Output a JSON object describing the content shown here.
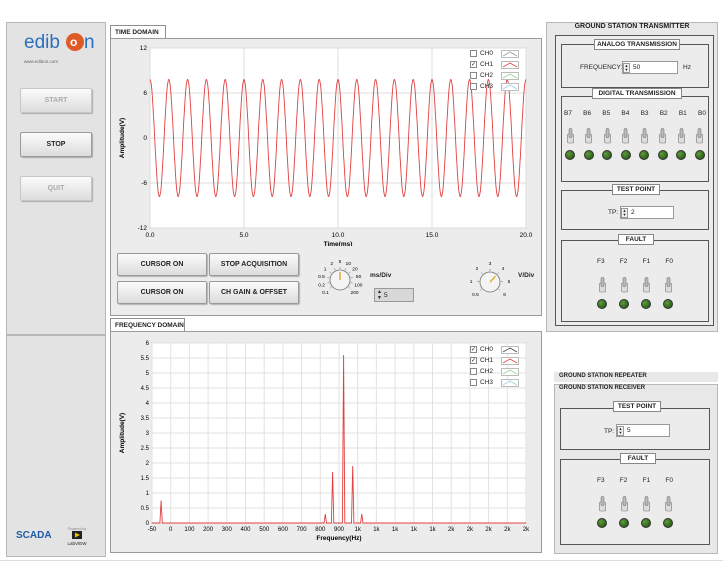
{
  "logo_text": "edibon",
  "logo_url": "www.edibon.com",
  "sidebar": {
    "start": "START",
    "stop": "STOP",
    "quit": "QUIT",
    "scada": "SCADA",
    "labview_powered": "Powered by",
    "labview": "LabVIEW"
  },
  "time_domain": {
    "tab": "TIME DOMAIN",
    "chart_data": {
      "type": "line",
      "title": "",
      "xlabel": "Time(ms)",
      "ylabel": "Amplitude(V)",
      "xlim": [
        0,
        20
      ],
      "ylim": [
        -12,
        12
      ],
      "xticks": [
        "0.0",
        "5.0",
        "10.0",
        "15.0",
        "20.0"
      ],
      "yticks": [
        "12",
        "6",
        "0",
        "-6",
        "-12"
      ],
      "grid": true,
      "series": [
        {
          "name": "CH1",
          "color": "#e04040",
          "type": "sine",
          "amplitude": 7.8,
          "frequency_khz": 1,
          "phase_deg": 90
        }
      ],
      "legend": [
        {
          "name": "CH0",
          "checked": false
        },
        {
          "name": "CH1",
          "checked": true
        },
        {
          "name": "CH2",
          "checked": false
        },
        {
          "name": "CH3",
          "checked": false
        }
      ]
    },
    "buttons": {
      "cursor_on_1": "CURSOR ON",
      "stop_acq": "STOP ACQUISITION",
      "cursor_on_2": "CURSOR ON",
      "ch_gain": "CH GAIN & OFFSET"
    },
    "ms_knob": {
      "label": "ms/Div",
      "ticks": [
        "0.1",
        "0.2",
        "0.5",
        "1",
        "2",
        "5",
        "10",
        "20",
        "50",
        "100",
        "200"
      ],
      "value": "5"
    },
    "v_knob": {
      "label": "V/Div",
      "ticks": [
        "0.5",
        "1",
        "2",
        "3",
        "4",
        "5",
        "6"
      ]
    }
  },
  "freq_domain": {
    "tab": "FREQUENCY DOMAIN",
    "chart_data": {
      "type": "line",
      "title": "",
      "xlabel": "Frequency(Hz)",
      "ylabel": "Amplitude(V)",
      "xlim": [
        -50,
        2000
      ],
      "ylim": [
        0,
        6
      ],
      "xticks": [
        "-50",
        "0",
        "100",
        "200",
        "300",
        "400",
        "500",
        "600",
        "700",
        "800",
        "900",
        "1k",
        "1k",
        "1k",
        "1k",
        "1k",
        "2k",
        "2k",
        "2k",
        "2k",
        "2k"
      ],
      "yticks": [
        "6",
        "5.5",
        "5",
        "4.5",
        "4",
        "3.5",
        "3",
        "2.5",
        "2",
        "1.5",
        "1",
        "0.5",
        "0"
      ],
      "grid": true,
      "series": [
        {
          "name": "CH1",
          "color": "#e04040",
          "peaks": [
            {
              "x": 0,
              "y": 0.75
            },
            {
              "x": 900,
              "y": 0.3
            },
            {
              "x": 940,
              "y": 1.7
            },
            {
              "x": 1000,
              "y": 5.6
            },
            {
              "x": 1050,
              "y": 1.9
            },
            {
              "x": 1100,
              "y": 0.3
            }
          ]
        }
      ],
      "legend": [
        {
          "name": "CH0",
          "checked": true
        },
        {
          "name": "CH1",
          "checked": true
        },
        {
          "name": "CH2",
          "checked": false
        },
        {
          "name": "CH3",
          "checked": false
        }
      ]
    }
  },
  "transmitter": {
    "title": "GROUND STATION TRANSMITTER",
    "analog_title": "ANALOG TRANSMISSION",
    "frequency_label": "FREQUENCY:",
    "frequency_value": "50",
    "frequency_unit": "Hz",
    "digital_title": "DIGITAL TRANSMISSION",
    "bits": [
      "B7",
      "B6",
      "B5",
      "B4",
      "B3",
      "B2",
      "B1",
      "B0"
    ],
    "test_point_title": "TEST POINT",
    "tp_label": "TP:",
    "tp_value": "2",
    "fault_title": "FAULT",
    "faults": [
      "F3",
      "F2",
      "F1",
      "F0"
    ]
  },
  "repeater": {
    "title": "GROUND STATION REPEATER"
  },
  "receiver": {
    "title": "GROUND STATION RECEIVER",
    "test_point_title": "TEST POINT",
    "tp_label": "TP:",
    "tp_value": "5",
    "fault_title": "FAULT",
    "faults": [
      "F3",
      "F2",
      "F1",
      "F0"
    ]
  }
}
